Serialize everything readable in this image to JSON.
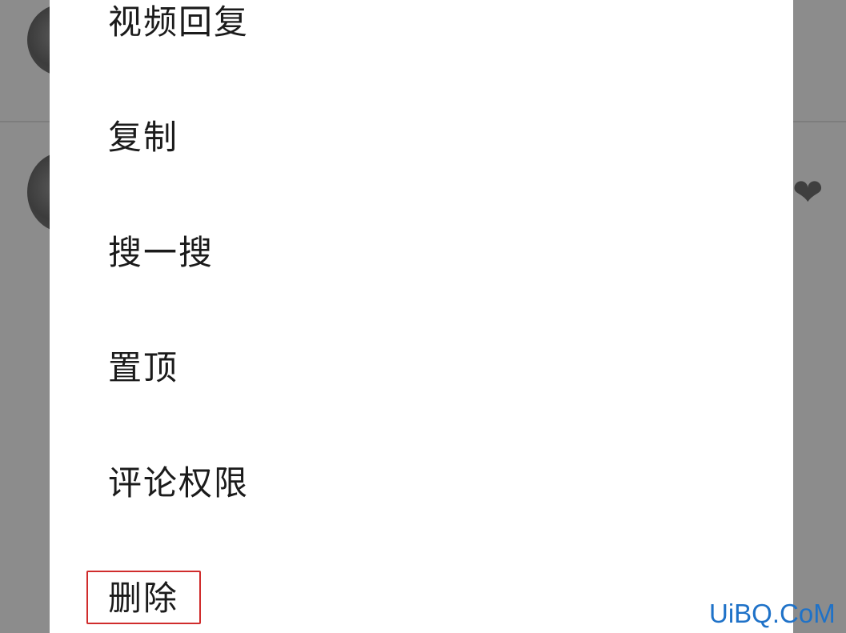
{
  "menu": {
    "items": [
      {
        "label": "视频回复"
      },
      {
        "label": "复制"
      },
      {
        "label": "搜一搜"
      },
      {
        "label": "置顶"
      },
      {
        "label": "评论权限"
      },
      {
        "label": "删除"
      }
    ],
    "highlighted_item": "删除"
  },
  "watermark": {
    "text": "UiBQ.CoM"
  },
  "colors": {
    "highlight_border": "#d02c2c",
    "watermark": "#1f72c8",
    "sheet_background": "#ffffff",
    "backdrop": "#8c8c8c"
  },
  "icons": {
    "background_like": "heart-icon"
  }
}
